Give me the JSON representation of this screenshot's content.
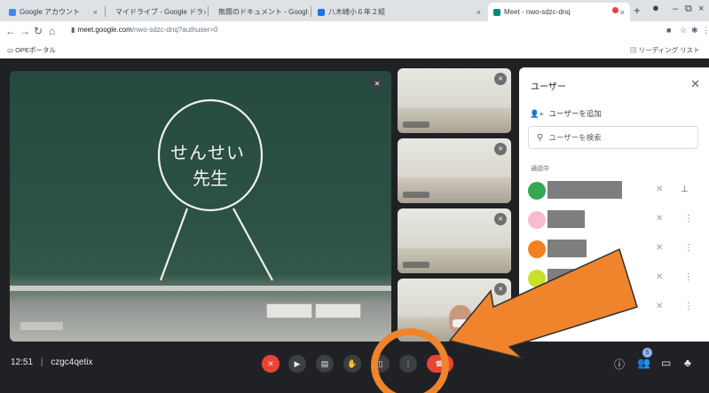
{
  "browser": {
    "tabs": [
      {
        "label": "Google アカウント",
        "close": "×",
        "color": "#4285f4"
      },
      {
        "label": "マイドライブ - Google ドラ",
        "close": "×",
        "color": "#0f9d58"
      },
      {
        "label": "無題のドキュメント - Googl",
        "close": "×",
        "color": "#4285f4"
      },
      {
        "label": "八木崎小６年２組",
        "close": "×",
        "color": "#1a73e8"
      },
      {
        "label": "Meet - nwo-sdzc-dnq",
        "close": "×",
        "color": "#00897b"
      }
    ],
    "new_tab": "+",
    "url_host": "meet.google.com",
    "url_path": "/nwo-sdzc-dnq?authuser=0",
    "bookmark": "OPEポータル",
    "reading_list": "リーディング リスト",
    "window_controls": [
      "–",
      "⧉",
      "×"
    ]
  },
  "meet": {
    "main_video": {
      "chalk_line1": "せんせい",
      "chalk_line2": "先生"
    },
    "people_panel": {
      "title": "ユーザー",
      "add_people": "ユーザーを追加",
      "search_placeholder": "ユーザーを検索",
      "section": "通話中",
      "participants": [
        {
          "avatar_color": "#34a853",
          "icon": "pin"
        },
        {
          "avatar_color": "#f8bbd0",
          "icon": "more"
        },
        {
          "avatar_color": "#f4801f",
          "icon": "more"
        },
        {
          "avatar_color": "#c6e02c",
          "icon": "more"
        },
        {
          "avatar_color": "#ab47bc",
          "icon": "more"
        }
      ]
    },
    "bottom_bar": {
      "time": "12:51",
      "separator": "|",
      "meeting_code": "czgc4qetix",
      "participant_count": "5"
    }
  },
  "annotation": {
    "circle_color": "#f0842c",
    "arrow_color": "#f0842c"
  }
}
